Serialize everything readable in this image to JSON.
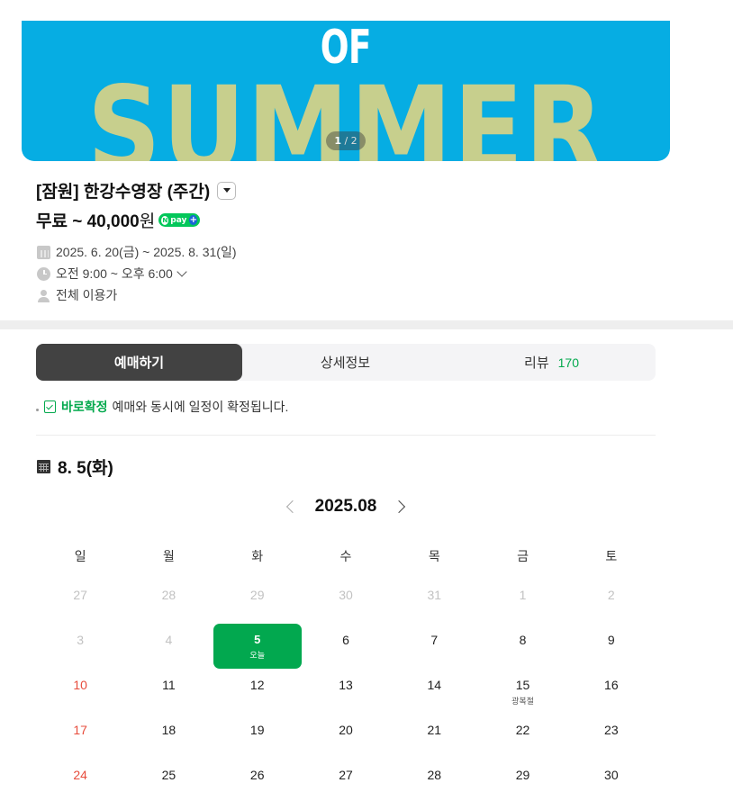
{
  "banner": {
    "line1": "OF",
    "line2": "SUMMER",
    "page_current": "1",
    "page_total": "2"
  },
  "product": {
    "title": "[잠원] 한강수영장 (주간)",
    "price": "무료 ~ 40,000",
    "currency": "원",
    "npay_label": "pay",
    "date_range": "2025. 6. 20(금) ~ 2025. 8. 31(일)",
    "hours": "오전 9:00 ~ 오후 6:00",
    "audience": "전체 이용가"
  },
  "tabs": [
    {
      "label": "예매하기",
      "active": true
    },
    {
      "label": "상세정보"
    },
    {
      "label": "리뷰",
      "count": "170"
    }
  ],
  "notice": {
    "highlight": "바로확정",
    "text": "예매와 동시에 일정이 확정됩니다."
  },
  "selected_date": "8. 5(화)",
  "calendar": {
    "month_label": "2025.08",
    "weekdays": [
      "일",
      "월",
      "화",
      "수",
      "목",
      "금",
      "토"
    ],
    "weeks": [
      [
        {
          "d": "27",
          "m": true
        },
        {
          "d": "28",
          "m": true
        },
        {
          "d": "29",
          "m": true
        },
        {
          "d": "30",
          "m": true
        },
        {
          "d": "31",
          "m": true
        },
        {
          "d": "1",
          "m": true
        },
        {
          "d": "2",
          "m": true
        }
      ],
      [
        {
          "d": "3",
          "m": true
        },
        {
          "d": "4",
          "m": true
        },
        {
          "d": "5",
          "today": true,
          "sub": "오늘"
        },
        {
          "d": "6"
        },
        {
          "d": "7"
        },
        {
          "d": "8"
        },
        {
          "d": "9"
        }
      ],
      [
        {
          "d": "10",
          "sun": true
        },
        {
          "d": "11"
        },
        {
          "d": "12"
        },
        {
          "d": "13"
        },
        {
          "d": "14"
        },
        {
          "d": "15",
          "sub": "광복절"
        },
        {
          "d": "16"
        }
      ],
      [
        {
          "d": "17",
          "sun": true
        },
        {
          "d": "18"
        },
        {
          "d": "19"
        },
        {
          "d": "20"
        },
        {
          "d": "21"
        },
        {
          "d": "22"
        },
        {
          "d": "23"
        }
      ],
      [
        {
          "d": "24",
          "sun": true
        },
        {
          "d": "25"
        },
        {
          "d": "26"
        },
        {
          "d": "27"
        },
        {
          "d": "28"
        },
        {
          "d": "29"
        },
        {
          "d": "30"
        }
      ]
    ]
  },
  "colors": {
    "accent_green": "#02a84f",
    "banner_blue": "#06ade3",
    "sunday_red": "#e74c3c"
  }
}
